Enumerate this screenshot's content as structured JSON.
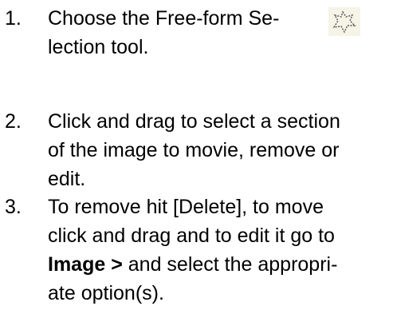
{
  "steps": [
    {
      "number": "1.",
      "lines": [
        "Choose the Free-form Se-",
        "lection tool."
      ],
      "icon": "free-form-selection-icon"
    },
    {
      "number": "2.",
      "lines": [
        "Click and drag to select a section",
        "of the image to movie, remove or",
        "edit."
      ]
    },
    {
      "number": "3.",
      "lines": [
        "To remove hit [Delete], to move",
        "click and drag and to edit it  go to"
      ],
      "line3_bold": "Image >",
      "line3_rest": " and select the appropri-",
      "line4": "ate option(s)."
    }
  ]
}
